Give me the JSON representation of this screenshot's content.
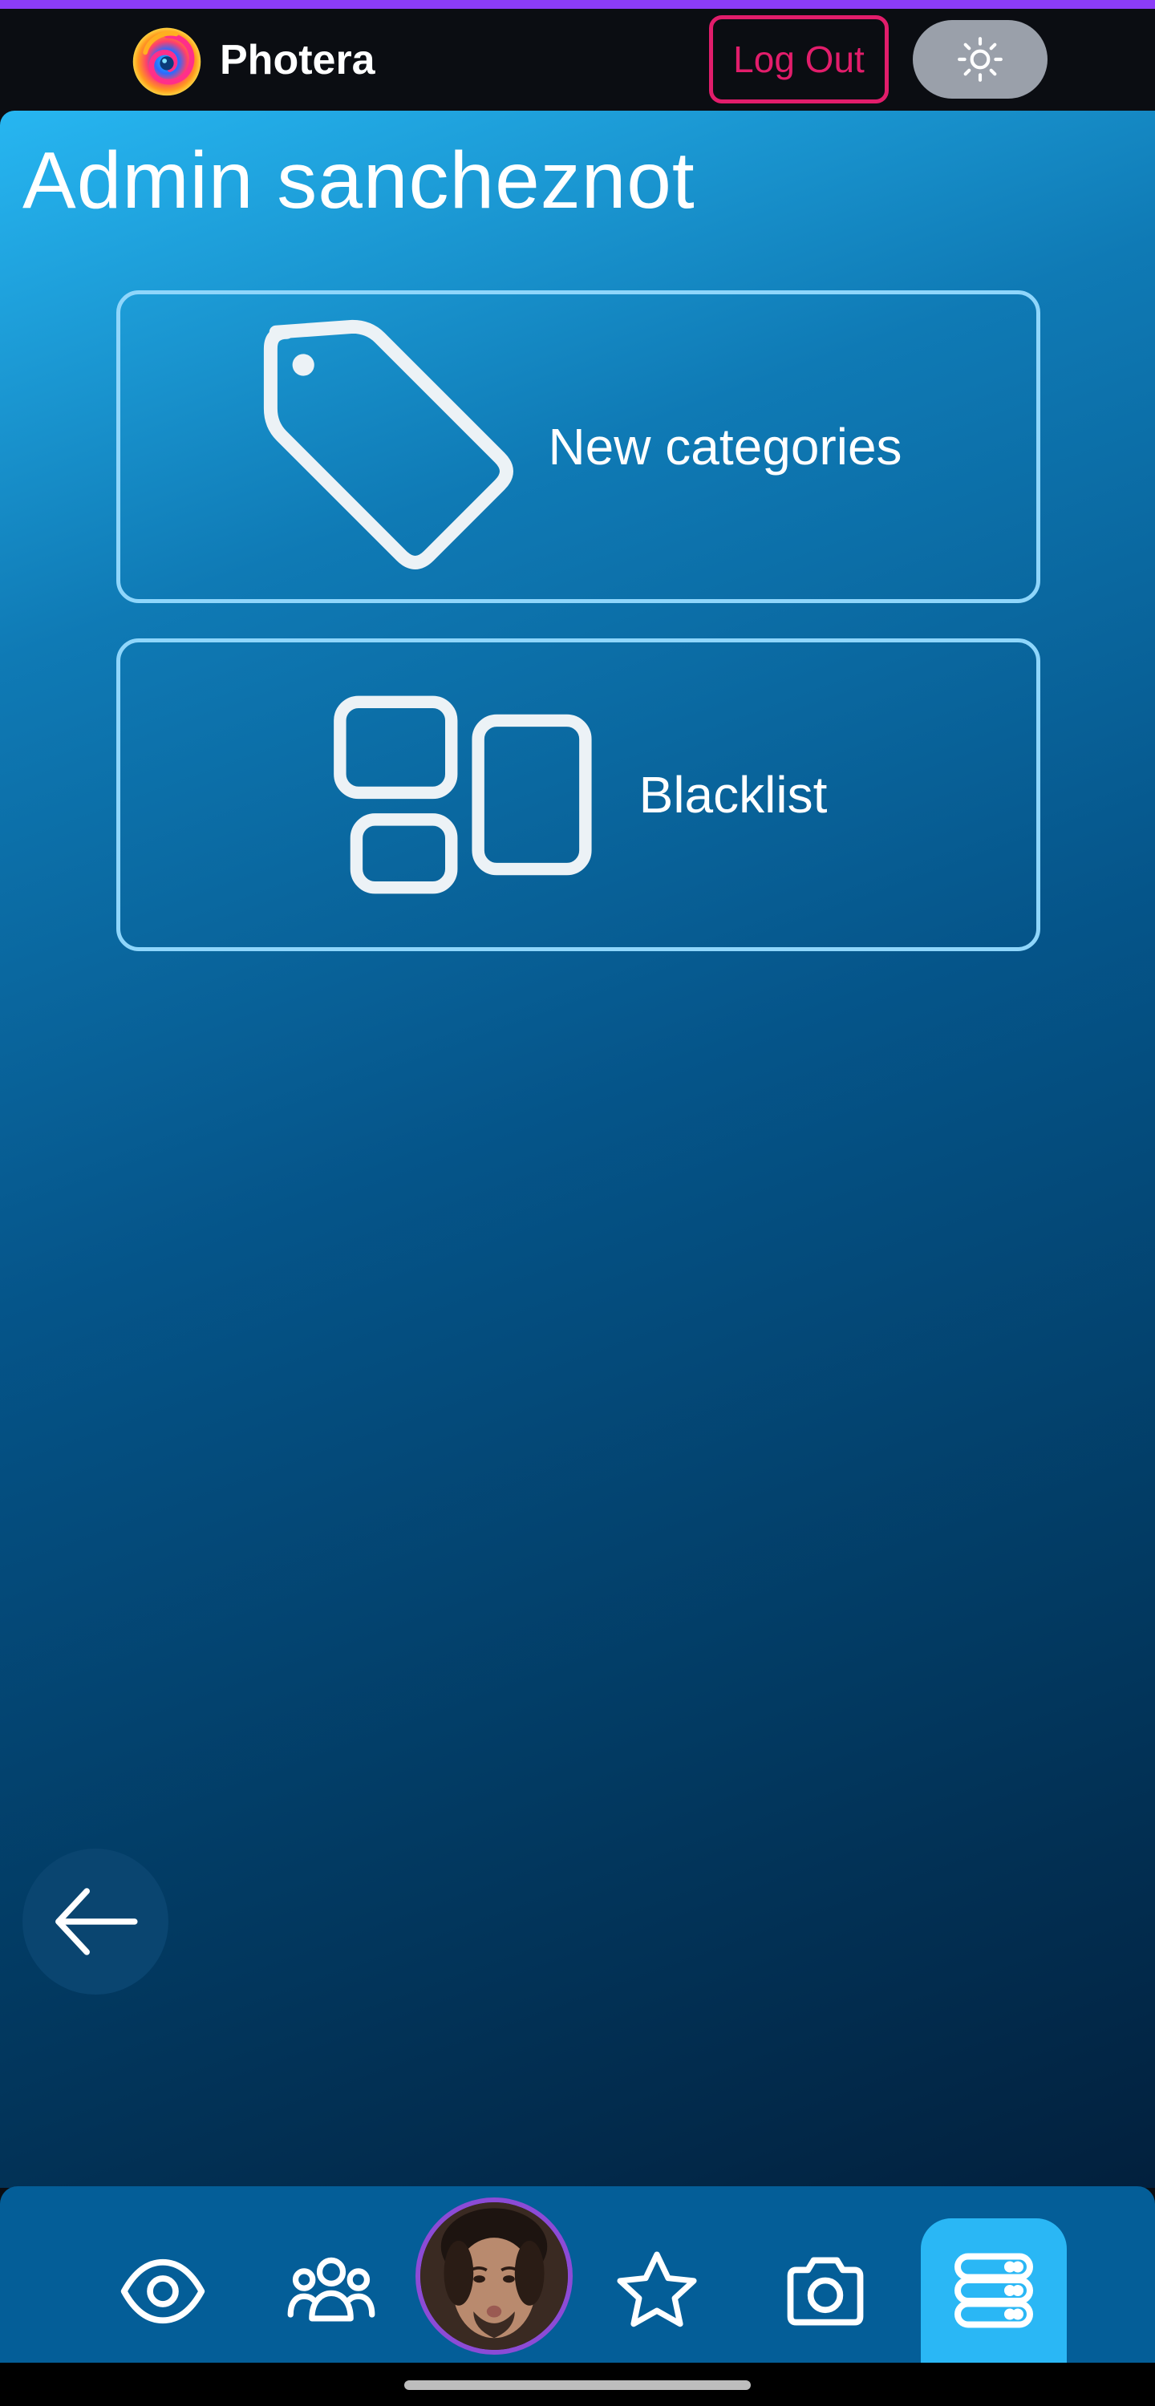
{
  "colors": {
    "accent_strip": "#8b3cf7",
    "logout": "#e21d6b",
    "card_border": "#8fd6fb",
    "nav_background": "#045e98",
    "nav_active": "#2ab7f5"
  },
  "header": {
    "brand_name": "Photera",
    "logo_icon": "swirl-logo",
    "logout_label": "Log Out",
    "theme_toggle_icon": "sun-icon"
  },
  "main": {
    "title": "Admin sancheznot",
    "cards": [
      {
        "label": "New categories",
        "icon": "tag-icon"
      },
      {
        "label": "Blacklist",
        "icon": "dashboard-layout-icon"
      }
    ],
    "back_icon": "arrow-left-icon"
  },
  "bottom_nav": {
    "items": [
      {
        "icon": "eye-icon"
      },
      {
        "icon": "users-group-icon"
      },
      {
        "icon": "user-avatar"
      },
      {
        "icon": "star-icon"
      },
      {
        "icon": "camera-icon"
      },
      {
        "icon": "database-icon",
        "active": true
      }
    ]
  }
}
